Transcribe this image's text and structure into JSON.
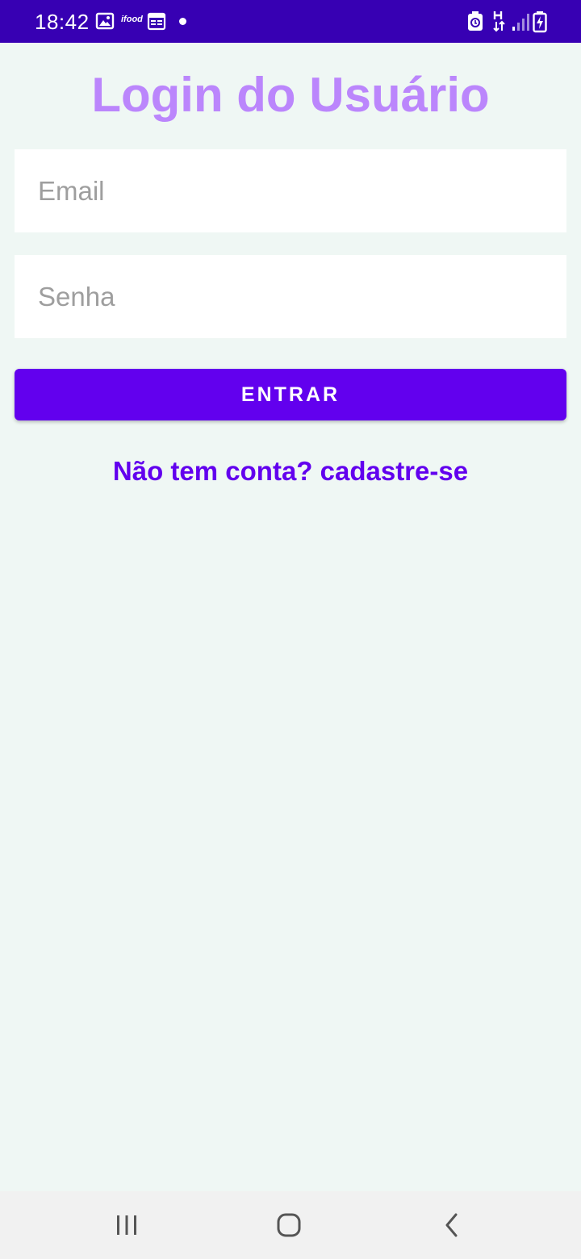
{
  "status_bar": {
    "time": "18:42",
    "app_icon_label": "ifood",
    "background": "#3700B3"
  },
  "login": {
    "title": "Login do Usuário",
    "email_placeholder": "Email",
    "password_placeholder": "Senha",
    "enter_button_label": "ENTRAR",
    "signup_link": "Não tem conta? cadastre-se"
  },
  "colors": {
    "title": "#BB86FC",
    "primary": "#6200EE",
    "background": "#EFF7F4"
  },
  "nav_bar": {
    "icons": [
      "recent-apps-icon",
      "home-icon",
      "back-icon"
    ]
  }
}
